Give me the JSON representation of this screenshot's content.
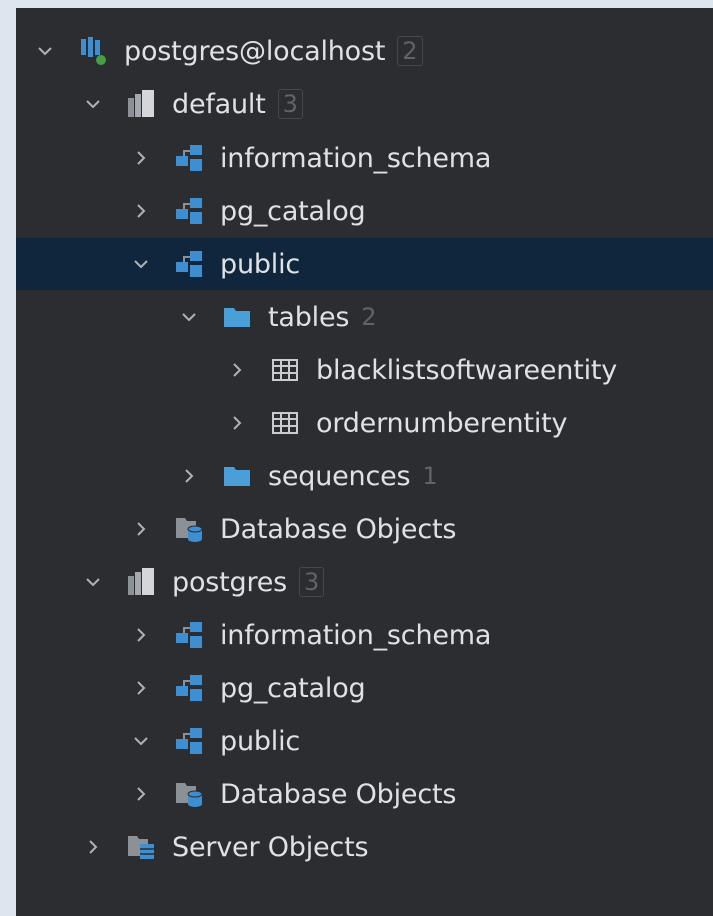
{
  "tree": {
    "root": {
      "label": "postgres@localhost",
      "badge": "2",
      "icon": "postgresql-datasource-icon"
    },
    "db_default": {
      "label": "default",
      "badge": "3",
      "icon": "database-icon"
    },
    "d_info": {
      "label": "information_schema",
      "icon": "schema-icon"
    },
    "d_pgcat": {
      "label": "pg_catalog",
      "icon": "schema-icon"
    },
    "d_public": {
      "label": "public",
      "icon": "schema-icon"
    },
    "d_tables": {
      "label": "tables",
      "count": "2",
      "icon": "folder-icon"
    },
    "t_blacklist": {
      "label": "blacklistsoftwareentity",
      "icon": "table-icon"
    },
    "t_order": {
      "label": "ordernumberentity",
      "icon": "table-icon"
    },
    "d_seq": {
      "label": "sequences",
      "count": "1",
      "icon": "folder-icon"
    },
    "d_dbobj": {
      "label": "Database Objects",
      "icon": "database-objects-icon"
    },
    "db_postgres": {
      "label": "postgres",
      "badge": "3",
      "icon": "database-icon"
    },
    "p_info": {
      "label": "information_schema",
      "icon": "schema-icon"
    },
    "p_pgcat": {
      "label": "pg_catalog",
      "icon": "schema-icon"
    },
    "p_public": {
      "label": "public",
      "icon": "schema-icon"
    },
    "p_dbobj": {
      "label": "Database Objects",
      "icon": "database-objects-icon"
    },
    "server_objects": {
      "label": "Server Objects",
      "icon": "server-objects-icon"
    }
  },
  "colors": {
    "panel_bg": "#2b2d30",
    "selected_row_bg": "#10263d",
    "text": "#dfe1e5",
    "muted": "#5f636a",
    "icon_blue": "#3d8fd1",
    "icon_gray": "#8c9097"
  }
}
